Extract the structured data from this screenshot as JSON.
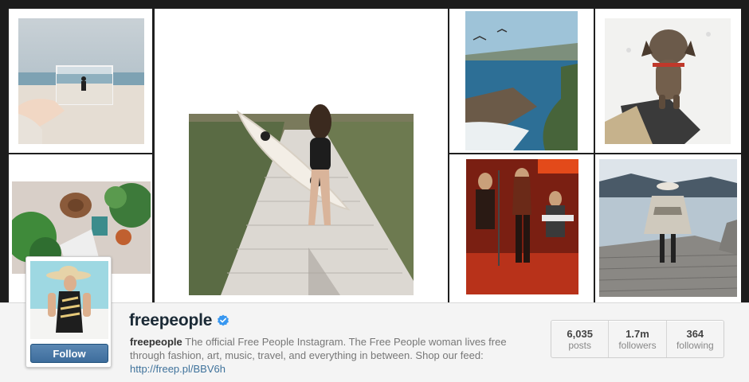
{
  "profile": {
    "username": "freepeople",
    "verified": true,
    "bio_name": "freepeople",
    "bio_text": " The official Free People Instagram. The Free People woman lives free through fashion, art, music, travel, and everything in between. Shop our feed: ",
    "bio_link": "http://freep.pl/BBV6h",
    "follow_label": "Follow"
  },
  "stats": [
    {
      "value": "6,035",
      "label": "posts"
    },
    {
      "value": "1.7m",
      "label": "followers"
    },
    {
      "value": "364",
      "label": "following"
    }
  ],
  "colors": {
    "follow_button": "#3e6d9c",
    "link": "#3f729b",
    "verified_badge": "#3897f0"
  },
  "icons": {
    "verified": "verified-badge-icon"
  }
}
